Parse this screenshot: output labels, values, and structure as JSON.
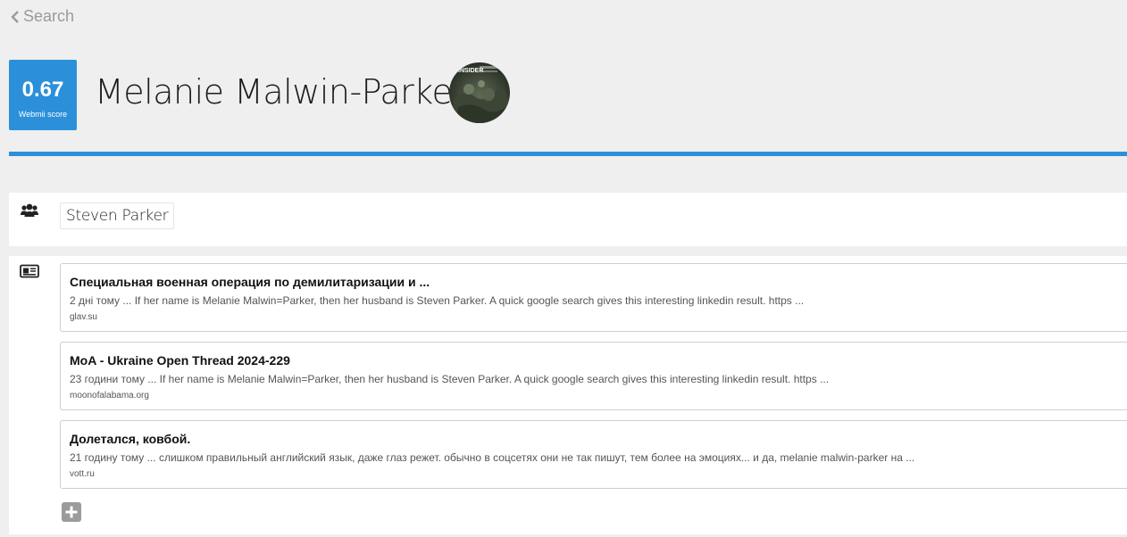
{
  "nav": {
    "back_label": "Search"
  },
  "profile": {
    "score": "0.67",
    "score_label": "Webmii score",
    "name": "Melanie Malwin-Parker",
    "avatar_text": "INSIDER"
  },
  "related": {
    "people": [
      "Steven Parker"
    ]
  },
  "results": [
    {
      "title": "Специальная военная операция по демилитаризации и ...",
      "snippet": "2 дні тому ... If her name is Melanie Malwin=Parker, then her husband is Steven Parker. A quick google search gives this interesting linkedin result. https ...",
      "domain": "glav.su"
    },
    {
      "title": "MoA - Ukraine Open Thread 2024-229",
      "snippet": "23 години тому ... If her name is Melanie Malwin=Parker, then her husband is Steven Parker. A quick google search gives this interesting linkedin result. https ...",
      "domain": "moonofalabama.org"
    },
    {
      "title": "Долетался, ковбой.",
      "snippet": "21 годину тому ... слишком правильный английский язык, даже глаз режет. обычно в соцсетях они не так пишут, тем более на эмоциях... и да, melanie malwin-parker на ...",
      "domain": "vott.ru"
    }
  ],
  "colors": {
    "accent": "#2b90d9",
    "background": "#efefef",
    "add_button": "#9b9b9b"
  },
  "icons": {
    "related_people": "users-icon",
    "news": "newspaper-icon",
    "add": "plus-icon",
    "back": "chevron-left-icon"
  }
}
